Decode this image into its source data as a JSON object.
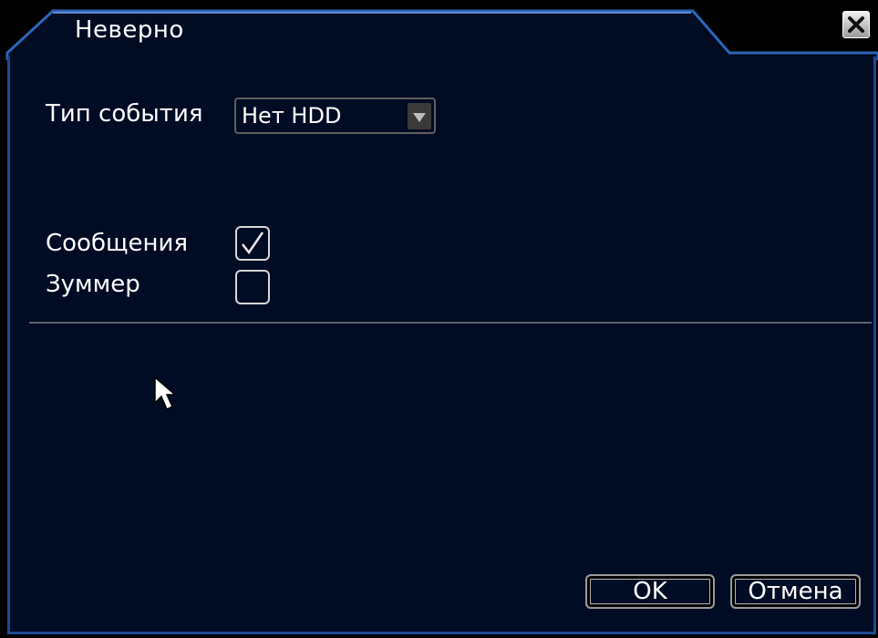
{
  "window": {
    "title": "Неверно"
  },
  "form": {
    "event_type_label": "Тип события",
    "event_type_value": "Нет HDD",
    "messages_label": "Сообщения",
    "messages_checked": true,
    "buzzer_label": "Зуммер",
    "buzzer_checked": false
  },
  "buttons": {
    "ok_label": "OK",
    "cancel_label": "Отмена"
  },
  "icons": {
    "close": "close-icon",
    "dropdown": "chevron-down-icon",
    "check": "checkmark-icon",
    "cursor": "mouse-pointer-icon"
  },
  "colors": {
    "panel_bg": "#000c23",
    "border_blue": "#1c4a90",
    "text": "#ffffff"
  }
}
